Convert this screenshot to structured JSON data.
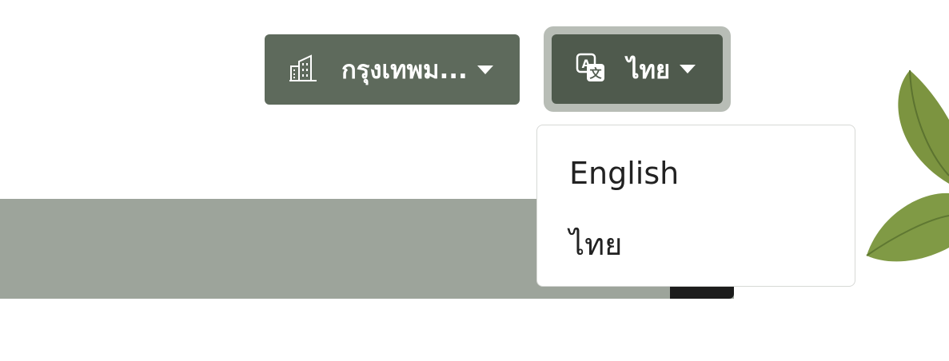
{
  "location_dropdown": {
    "icon": "building-icon",
    "label": "กรุงเทพม..."
  },
  "language_dropdown": {
    "icon": "translate-icon",
    "label": "ไทย",
    "options": [
      {
        "label": "English"
      },
      {
        "label": "ไทย"
      }
    ]
  },
  "colors": {
    "button_primary": "#5e6a5c",
    "button_active": "#4f5a4d",
    "focus_ring": "#b8bdb6",
    "banner": "#9da49b"
  }
}
